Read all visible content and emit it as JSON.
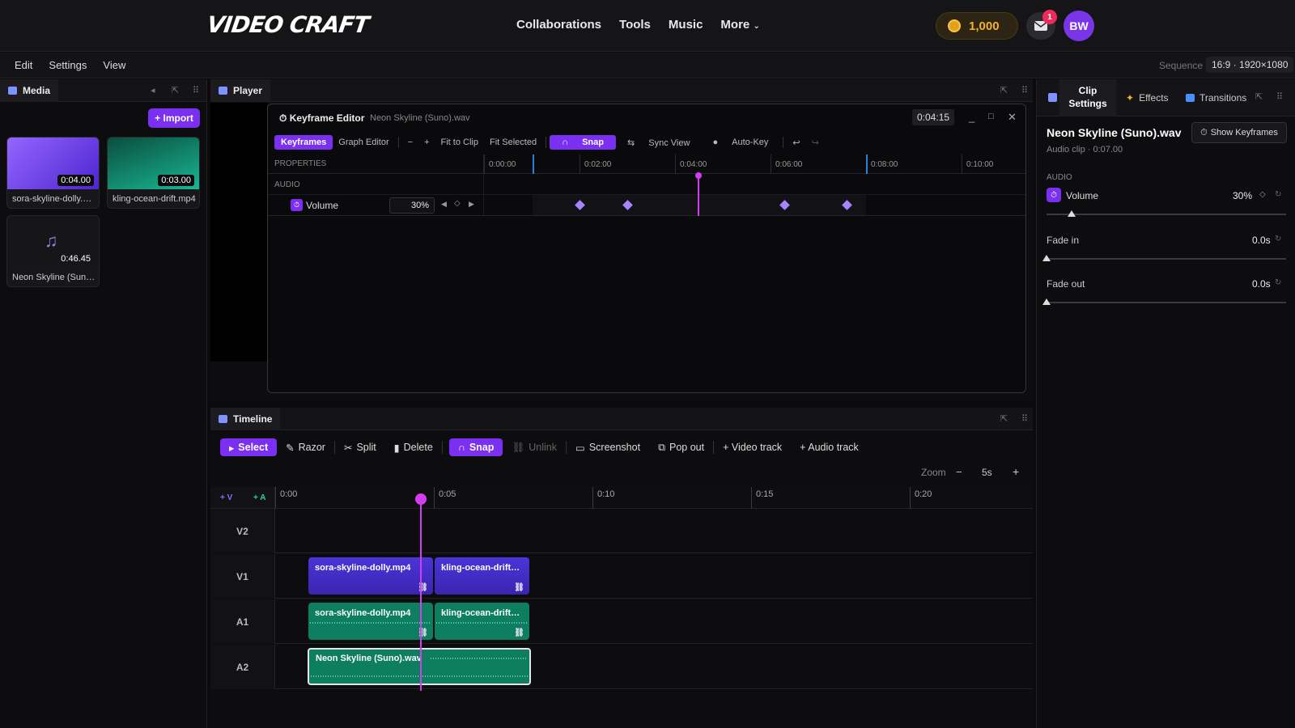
{
  "app": {
    "logo": "VIDEO CRAFT",
    "nav": [
      "Collaborations",
      "Tools",
      "Music",
      "More"
    ],
    "coins": "1,000",
    "mail_badge": "1",
    "avatar": "BW"
  },
  "menu": {
    "items": [
      "Edit",
      "Settings",
      "View"
    ],
    "sequence_label": "Sequence",
    "sequence_value": "16:9 · 1920×1080"
  },
  "media": {
    "title": "Media",
    "import": "+ Import",
    "items": [
      {
        "name": "sora-skyline-dolly.mp4",
        "duration": "0:04.00",
        "thumb": [
          "#5b2ee0",
          "#9466ff"
        ]
      },
      {
        "name": "kling-ocean-drift.mp4",
        "duration": "0:03.00",
        "thumb": [
          "#0a5a44",
          "#19c2a0"
        ]
      },
      {
        "name": "Neon Skyline (Suno).wav",
        "duration": "0:46.45",
        "thumb": [
          "#161619",
          "#161619"
        ]
      }
    ]
  },
  "player": {
    "title": "Player"
  },
  "keyframe_editor": {
    "title": "Keyframe Editor",
    "file": "Neon Skyline (Suno).wav",
    "time": "0:04:15",
    "tabs": [
      "Keyframes",
      "Graph Editor"
    ],
    "tools": [
      "−",
      "+",
      "Fit to Clip",
      "Fit Selected",
      "Snap",
      "Sync View",
      "Auto-Key"
    ],
    "properties_header": "PROPERTIES",
    "group": "AUDIO",
    "property": "Volume",
    "value": "30%",
    "ruler": [
      "0:00:00",
      "0:02:00",
      "0:04:00",
      "0:06:00",
      "0:08:00",
      "0:10:00"
    ]
  },
  "timeline": {
    "title": "Timeline",
    "tools": [
      "Select",
      "Razor",
      "Split",
      "Delete",
      "Snap",
      "Unlink",
      "Screenshot",
      "Pop out",
      "+ Video track",
      "+ Audio track"
    ],
    "zoom_label": "Zoom",
    "zoom_value": "5s",
    "add_v": "+ V",
    "add_a": "+ A",
    "ruler": [
      "0:00",
      "0:05",
      "0:10",
      "0:15",
      "0:20"
    ],
    "tracks": [
      "V2",
      "V1",
      "A1",
      "A2"
    ],
    "clips": {
      "v1a": "sora-skyline-dolly.mp4",
      "v1b": "kling-ocean-drift.mp4",
      "a1a": "sora-skyline-dolly.mp4",
      "a1b": "kling-ocean-drift.mp4",
      "a2": "Neon Skyline (Suno).wav"
    }
  },
  "clip_settings": {
    "tabs": [
      "Clip Settings",
      "Effects",
      "Transitions"
    ],
    "title": "Neon Skyline (Suno).wav",
    "subtitle": "Audio clip · 0:07.00",
    "show_keyframes": "Show Keyframes",
    "section": "AUDIO",
    "volume_label": "Volume",
    "volume_value": "30%",
    "fade_in_label": "Fade in",
    "fade_in_value": "0.0s",
    "fade_out_label": "Fade out",
    "fade_out_value": "0.0s"
  },
  "colors": {
    "accent": "#7b2ff0",
    "playhead": "#d33cf0",
    "keyframe": "#a884ff"
  }
}
